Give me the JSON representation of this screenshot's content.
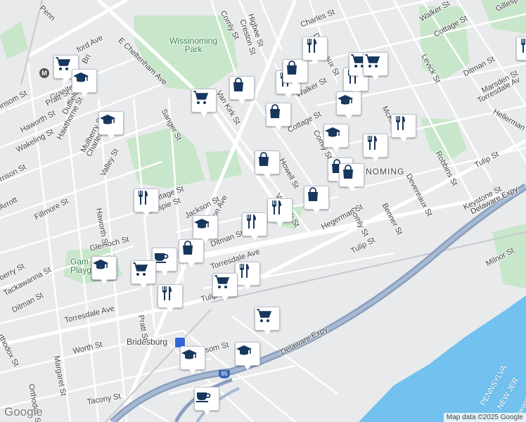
{
  "colors": {
    "land": "#e9eaec",
    "park": "#c8e6c9",
    "water": "#72c1ee",
    "highway": "#8a9fbf",
    "road": "#ffffff",
    "pin_icon": "#17365d"
  },
  "labels": {
    "wissinoming_park": "Wissinoming\nPark",
    "wissinoming": "NOMING",
    "gambrel_playground": "Gam\nPlaygr",
    "bridesburg": "Bridesburg",
    "pennsylvania": "PENNSYLVA",
    "new_jersey": "NEW JER",
    "delaware_river": "Delaware R",
    "delaware_expy_1": "Delaware Expy",
    "delaware_expy_2": "Delaware Expy",
    "route_95": "95",
    "metro": "M",
    "streets": {
      "e_cheltenham_ave": "E Cheltenham Ave",
      "comly_st_1": "Comly St",
      "higbee_st": "Higbee St",
      "creston_st": "Creston St",
      "charles_st_1": "Charles St",
      "walker_st_1": "Walker St",
      "gillespie_st_1": "Gillesp",
      "cottage_st_1": "Cottage St",
      "levick_st": "Levick St",
      "ditman_st_1": "Ditman St",
      "marsden_st": "Marsden St",
      "torresdale_ave_1": "Torresdale Av",
      "hellerman_st": "Hellerman",
      "robbins_st": "Robbins St",
      "tulip_st_1": "Tulip St",
      "keystone_st": "Keystone St",
      "devereaux_st_1": "Devereaux St",
      "devereaux_st_2": "Devereaux St",
      "mckinley_st": "McKinley",
      "benner_st": "Benner St",
      "comly_st_2": "Comly St",
      "comly_st_3": "Comly St",
      "hegerman_st": "Hegerman St",
      "tulip_st_2": "Tulip St",
      "milnor_st": "Milnor St",
      "delaware_expy": "Delaware Expy",
      "van_kirk_st_1": "Van Kirk St",
      "van_kirk_st_2": "Van Kirk St",
      "howell_st": "Howell St",
      "cottage_st_2": "Cottage St",
      "walker_st_2": "Walker St",
      "harbison_ave": "Harbison Ave",
      "gillespie_st_2": "Gillespie St",
      "cottage_st_3": "Cottage St",
      "jackson_st": "Jackson St",
      "ditman_st_2": "Ditman St",
      "torresdale_ave_2": "Torresdale Ave",
      "torresdale_ave_3": "Torresdale Ave",
      "tulip_st_3": "Tulip St",
      "glenloch_st": "Glenloch St",
      "sanger_st": "Sanger St",
      "charles_st_2": "Charles St",
      "valley_st": "Valley St",
      "mulberry_st": "Mulberry St",
      "hawthorne_st": "Hawthorne St",
      "duffield_st": "Duffield St",
      "granite_st": "Granite St",
      "pratt_st_1": "Pratt St",
      "pratt_st_2": "Pratt St",
      "haworth_st_1": "Haworth St",
      "haworth_st_2": "Haworth St",
      "wakeling_st": "Wakeling St",
      "fillmore_st": "Fillmore St",
      "harrison_st": "rrison St",
      "kinsom_st": "insom St",
      "frankford_ave": "ford Ave",
      "arrott": "Arrott",
      "tackawanna_st": "Tackawanna St",
      "ditman_st_3": "Ditman St",
      "orthodox_st_1": "rthodox St",
      "orthodox_st_2": "Orthodox St",
      "margaret_st": "Margaret St",
      "worth_st": "Worth St",
      "tacony_st": "Tacony St",
      "bridge_st": "Bri",
      "penn_st": "Penn",
      "lefevre": "berry St",
      "gansom_st": "nsom St"
    }
  },
  "pins": [
    {
      "id": "grocery-1",
      "icon": "cart"
    },
    {
      "id": "school-1",
      "icon": "school"
    },
    {
      "id": "school-2",
      "icon": "school"
    },
    {
      "id": "grocery-2",
      "icon": "cart"
    },
    {
      "id": "shop-1",
      "icon": "bag"
    },
    {
      "id": "food-1",
      "icon": "utensils"
    },
    {
      "id": "shop-2",
      "icon": "bag"
    },
    {
      "id": "food-2",
      "icon": "utensils"
    },
    {
      "id": "food-3",
      "icon": "utensils"
    },
    {
      "id": "grocery-3",
      "icon": "cart"
    },
    {
      "id": "grocery-4",
      "icon": "cart"
    },
    {
      "id": "food-4",
      "icon": "utensils"
    },
    {
      "id": "school-3",
      "icon": "school"
    },
    {
      "id": "shop-3",
      "icon": "bag"
    },
    {
      "id": "food-5",
      "icon": "utensils"
    },
    {
      "id": "school-4",
      "icon": "school"
    },
    {
      "id": "food-6",
      "icon": "utensils"
    },
    {
      "id": "shop-4",
      "icon": "bag"
    },
    {
      "id": "shop-5",
      "icon": "bag"
    },
    {
      "id": "shop-6",
      "icon": "bag"
    },
    {
      "id": "shop-7",
      "icon": "bag"
    },
    {
      "id": "food-7",
      "icon": "utensils"
    },
    {
      "id": "food-8",
      "icon": "utensils"
    },
    {
      "id": "school-5",
      "icon": "school"
    },
    {
      "id": "food-9",
      "icon": "utensils"
    },
    {
      "id": "school-6",
      "icon": "school"
    },
    {
      "id": "shop-8",
      "icon": "bag"
    },
    {
      "id": "cafe-1",
      "icon": "cup"
    },
    {
      "id": "grocery-5",
      "icon": "cart"
    },
    {
      "id": "school-7",
      "icon": "school"
    },
    {
      "id": "food-10",
      "icon": "utensils"
    },
    {
      "id": "grocery-6",
      "icon": "cart"
    },
    {
      "id": "food-11",
      "icon": "utensils"
    },
    {
      "id": "grocery-7",
      "icon": "cart"
    },
    {
      "id": "school-8",
      "icon": "school"
    },
    {
      "id": "school-9",
      "icon": "school"
    },
    {
      "id": "cafe-2",
      "icon": "cup"
    }
  ],
  "branding": {
    "logo": "Google",
    "attribution": "Map data ©2025 Google"
  }
}
